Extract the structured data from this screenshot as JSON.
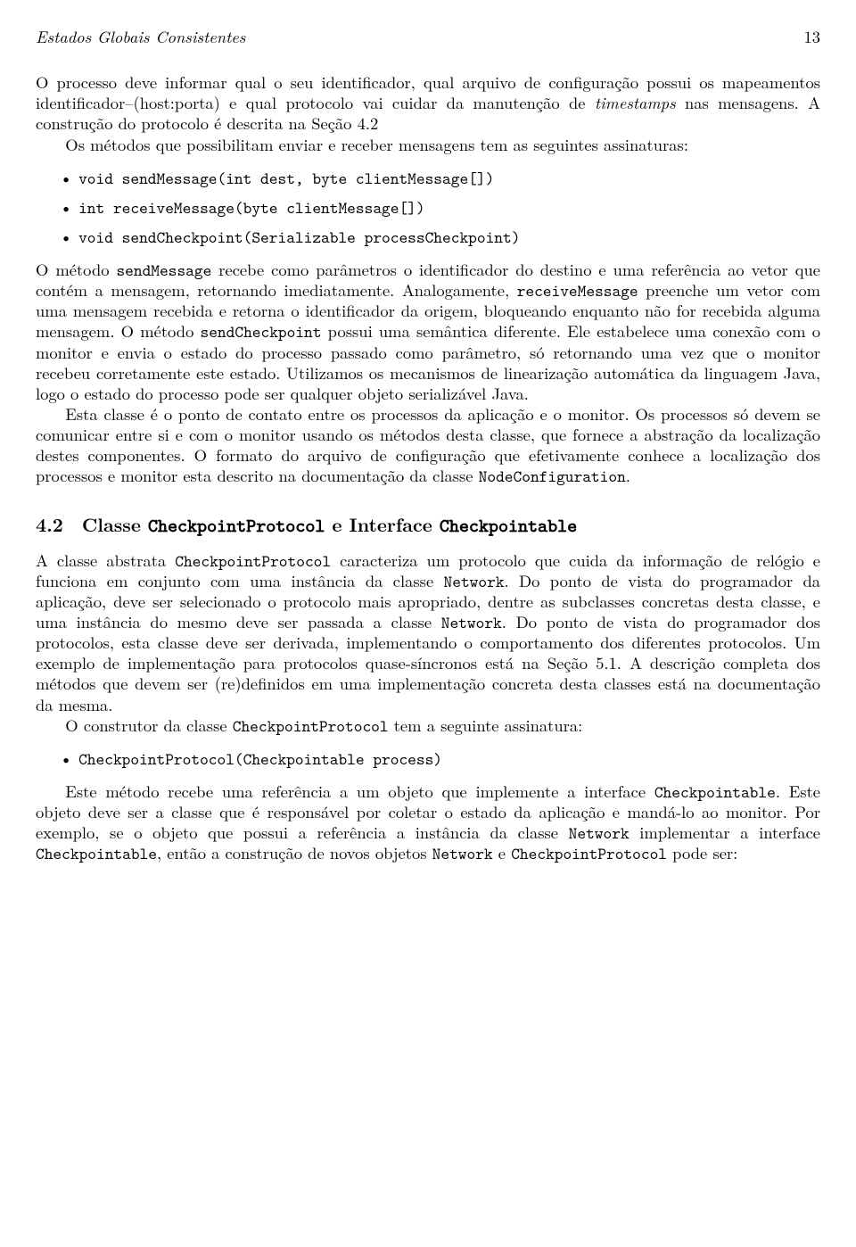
{
  "header": {
    "running_title": "Estados Globais Consistentes",
    "page_number": "13"
  },
  "intro": {
    "p1_a": "O processo deve informar qual o seu identificador, qual arquivo de configuração possui os mapeamentos identificador–(host:porta) e qual protocolo vai cuidar da manutenção de ",
    "p1_b": "timestamps",
    "p1_c": " nas mensagens. A construção do protocolo é descrita na Seção 4.2",
    "p2": "Os métodos que possibilitam enviar e receber mensagens tem as seguintes assinaturas:"
  },
  "sig_list": {
    "i1": "void sendMessage(int dest, byte clientMessage[])",
    "i2": "int receiveMessage(byte clientMessage[])",
    "i3": "void sendCheckpoint(Serializable processCheckpoint)"
  },
  "body": {
    "p3_a": "O método ",
    "p3_b": "sendMessage",
    "p3_c": " recebe como parâmetros o identificador do destino e uma referência ao vetor que contém a mensagem, retornando imediatamente. Analogamente, ",
    "p3_d": "receiveMessage",
    "p3_e": " preenche um vetor com uma mensagem recebida e retorna o identificador da origem, bloqueando enquanto não for recebida alguma mensagem. O método ",
    "p3_f": "sendCheckpoint",
    "p3_g": " possui uma semântica diferente. Ele estabelece uma conexão com o monitor e envia o estado do processo passado como parâmetro, só retornando uma vez que o monitor recebeu corretamente este estado. Utilizamos os mecanismos de linearização automática da linguagem Java, logo o estado do processo pode ser qualquer objeto serializável Java.",
    "p4_a": "Esta classe é o ponto de contato entre os processos da aplicação e o monitor. Os processos só devem se comunicar entre si e com o monitor usando os métodos desta classe, que fornece a abstração da localização destes componentes. O formato do arquivo de configuração que efetivamente conhece a localização dos processos e monitor esta descrito na documentação da classe ",
    "p4_b": "NodeConfiguration",
    "p4_c": "."
  },
  "section": {
    "number": "4.2",
    "title_a": "Classe ",
    "title_b": "CheckpointProtocol",
    "title_c": " e Interface ",
    "title_d": "Checkpointable"
  },
  "sec_body": {
    "p5_a": "A classe abstrata ",
    "p5_b": "CheckpointProtocol",
    "p5_c": " caracteriza um protocolo que cuida da informação de relógio e funciona em conjunto com uma instância da classe ",
    "p5_d": "Network",
    "p5_e": ". Do ponto de vista do programador da aplicação, deve ser selecionado o protocolo mais apropriado, dentre as subclasses concretas desta classe, e uma instância do mesmo deve ser passada a classe ",
    "p5_f": "Network",
    "p5_g": ". Do ponto de vista do programador dos protocolos, esta classe deve ser derivada, implementando o comportamento dos diferentes protocolos. Um exemplo de implementação para protocolos quase-síncronos está na Seção 5.1. A descrição completa dos métodos que devem ser (re)definidos em uma implementação concreta desta classes está na documentação da mesma.",
    "p6_a": "O construtor da classe ",
    "p6_b": "CheckpointProtocol",
    "p6_c": " tem a seguinte assinatura:"
  },
  "ctor_list": {
    "i1": "CheckpointProtocol(Checkpointable process)"
  },
  "tail": {
    "p7_a": "Este método recebe uma referência a um objeto que implemente a interface ",
    "p7_b": "Checkpointable",
    "p7_c": ". Este objeto deve ser a classe que é responsável por coletar o estado da aplicação e mandá-lo ao monitor. Por exemplo, se o objeto que possui a referência a instância da classe ",
    "p7_d": "Network",
    "p7_e": " implementar a interface ",
    "p7_f": "Checkpointable",
    "p7_g": ", então a construção de novos objetos ",
    "p7_h": "Network",
    "p7_i": " e ",
    "p7_j": "CheckpointProtocol",
    "p7_k": " pode ser:"
  }
}
